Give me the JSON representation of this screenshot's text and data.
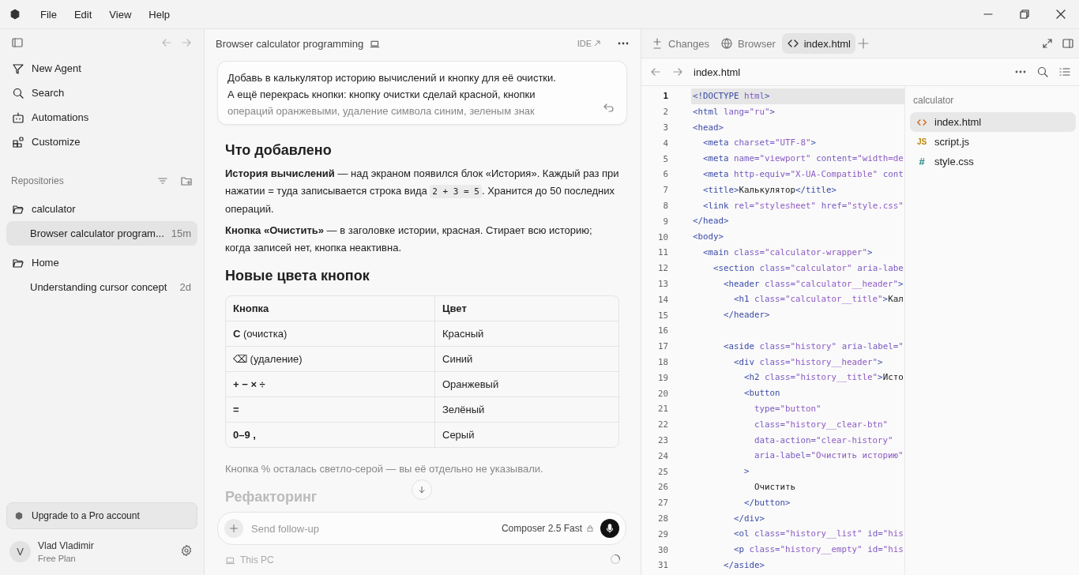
{
  "menu": [
    "File",
    "Edit",
    "View",
    "Help"
  ],
  "sidebar": {
    "nav": [
      {
        "label": "New Agent",
        "kind": "agent"
      },
      {
        "label": "Search",
        "kind": "search"
      },
      {
        "label": "Automations",
        "kind": "robot"
      },
      {
        "label": "Customize",
        "kind": "blocks"
      }
    ],
    "repositories_label": "Repositories",
    "repositories": [
      {
        "name": "calculator",
        "chats": [
          {
            "title": "Browser calculator program...",
            "age": "15m",
            "selected": true
          }
        ]
      },
      {
        "name": "Home",
        "chats": [
          {
            "title": "Understanding cursor concept",
            "age": "2d",
            "selected": false
          }
        ]
      }
    ],
    "upgrade": "Upgrade to a Pro account",
    "user": {
      "initial": "V",
      "name": "Vlad Vladimir",
      "plan": "Free Plan"
    }
  },
  "chat": {
    "title": "Browser calculator programming",
    "ide_link": "IDE",
    "prompt": [
      "Добавь в калькулятор историю вычислений и кнопку для её очистки.",
      "А ещё перекрась кнопки: кнопку очистки сделай красной, кнопки",
      "операций оранжевыми, удаление символа синим, зеленым знак"
    ],
    "blocks": [
      {
        "kind": "heading",
        "text": "Что добавлено"
      },
      {
        "kind": "paragraph",
        "parts": [
          {
            "kind": "text",
            "text": "**История вычислений** — над экраном появился блок «История». Каждый раз при нажатии = туда записывается строка вида "
          },
          {
            "kind": "code",
            "text": "2 + 3 = 5"
          },
          {
            "kind": "text",
            "text": ". Хранится до 50 последних операций."
          }
        ]
      },
      {
        "kind": "paragraph",
        "parts": [
          {
            "kind": "text",
            "text": "**Кнопка «Очистить»** — в заголовке истории, красная. Стирает всю историю; когда записей нет, кнопка неактивна."
          }
        ]
      },
      {
        "kind": "heading",
        "text": "Новые цвета кнопок"
      },
      {
        "kind": "table",
        "columns": [
          "Кнопка",
          "Цвет"
        ],
        "rows": [
          {
            "key": "**С** (очистка)",
            "strong": false,
            "value": "Красный"
          },
          {
            "key": "⌫ (удаление)",
            "strong": false,
            "value": "Синий"
          },
          {
            "key": "+ − × ÷",
            "strong": true,
            "value": "Оранжевый"
          },
          {
            "key": "=",
            "strong": true,
            "value": "Зелёный"
          },
          {
            "key": "0–9 ,",
            "strong": true,
            "value": "Серый"
          }
        ]
      },
      {
        "kind": "note",
        "text": "Кнопка % осталась светло-серой — вы её отдельно не указывали."
      },
      {
        "kind": "faded_heading",
        "text": "Рефакторинг"
      }
    ],
    "composer": {
      "placeholder": "Send follow-up",
      "model": "Composer 2.5 Fast"
    },
    "location": "This PC"
  },
  "editor": {
    "tabs": [
      {
        "label": "Changes",
        "kind": "changes",
        "selected": false
      },
      {
        "label": "Browser",
        "kind": "browser",
        "selected": false
      },
      {
        "label": "index.html",
        "kind": "code",
        "selected": true
      }
    ],
    "file": "index.html",
    "lines": [
      {
        "n": "1",
        "text": "<!DOCTYPE html>",
        "current": true
      },
      {
        "n": "2",
        "text": "<html lang=\"ru\">",
        "current": false
      },
      {
        "n": "3",
        "text": "<head>",
        "current": false
      },
      {
        "n": "4",
        "text": "  <meta charset=\"UTF-8\">",
        "current": false
      },
      {
        "n": "5",
        "text": "  <meta name=\"viewport\" content=\"width=de",
        "current": false
      },
      {
        "n": "6",
        "text": "  <meta http-equiv=\"X-UA-Compatible\" cont",
        "current": false
      },
      {
        "n": "7",
        "text": "  <title>Калькулятор</title>",
        "current": false
      },
      {
        "n": "8",
        "text": "  <link rel=\"stylesheet\" href=\"style.css\"",
        "current": false
      },
      {
        "n": "9",
        "text": "</head>",
        "current": false
      },
      {
        "n": "10",
        "text": "<body>",
        "current": false
      },
      {
        "n": "11",
        "text": "  <main class=\"calculator-wrapper\">",
        "current": false
      },
      {
        "n": "12",
        "text": "    <section class=\"calculator\" aria-labe",
        "current": false
      },
      {
        "n": "13",
        "text": "      <header class=\"calculator__header\">",
        "current": false
      },
      {
        "n": "14",
        "text": "        <h1 class=\"calculator__title\">Кал",
        "current": false
      },
      {
        "n": "15",
        "text": "      </header>",
        "current": false
      },
      {
        "n": "16",
        "current": false
      },
      {
        "n": "17",
        "text": "      <aside class=\"history\" aria-label=\"",
        "current": false
      },
      {
        "n": "18",
        "text": "        <div class=\"history__header\">",
        "current": false
      },
      {
        "n": "19",
        "text": "          <h2 class=\"history__title\">Исто",
        "current": false
      },
      {
        "n": "20",
        "text": "          <button",
        "current": false
      },
      {
        "n": "21",
        "text": "            type=\"button\"",
        "current": false
      },
      {
        "n": "22",
        "text": "            class=\"history__clear-btn\"",
        "current": false
      },
      {
        "n": "23",
        "text": "            data-action=\"clear-history\"",
        "current": false
      },
      {
        "n": "24",
        "text": "            aria-label=\"Очистить историю\"",
        "current": false
      },
      {
        "n": "25",
        "text": "          >",
        "current": false
      },
      {
        "n": "26",
        "text": "            Очистить",
        "current": false
      },
      {
        "n": "27",
        "text": "          </button>",
        "current": false
      },
      {
        "n": "28",
        "text": "        </div>",
        "current": false
      },
      {
        "n": "29",
        "text": "        <ol class=\"history__list\" id=\"his",
        "current": false
      },
      {
        "n": "30",
        "text": "        <p class=\"history__empty\" id=\"his",
        "current": false
      },
      {
        "n": "31",
        "text": "      </aside>",
        "current": false
      }
    ],
    "tree_title": "calculator",
    "files": [
      {
        "name": "index.html",
        "kind": "html",
        "selected": true
      },
      {
        "name": "script.js",
        "kind": "js",
        "badge": "JS",
        "selected": false
      },
      {
        "name": "style.css",
        "kind": "css",
        "badge": "#",
        "selected": false
      }
    ]
  }
}
